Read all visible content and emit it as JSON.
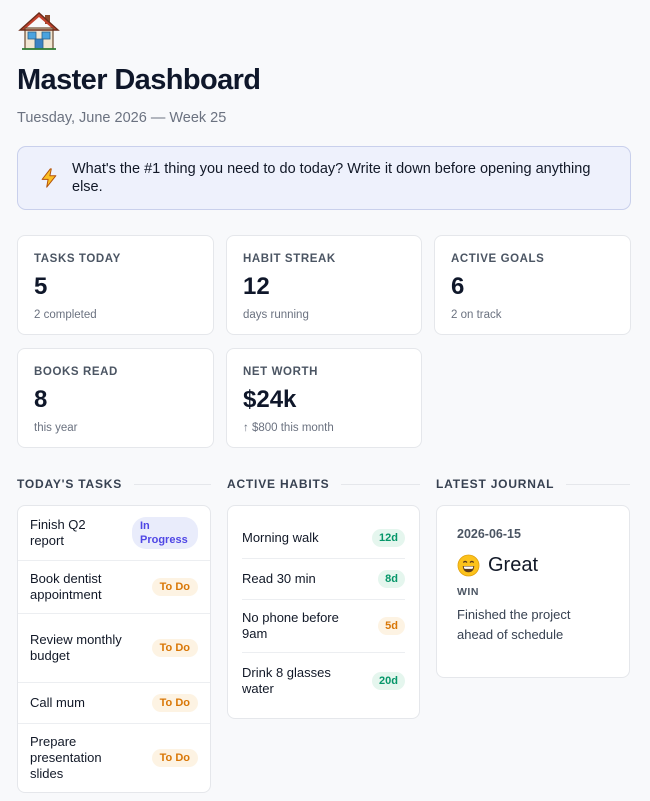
{
  "header": {
    "icon": "house-icon",
    "title": "Master Dashboard",
    "subtitle": "Tuesday, June 2026 — Week 25"
  },
  "callout": {
    "icon": "lightning-bolt-icon",
    "text": "What's the #1 thing you need to do today? Write it down before opening anything else."
  },
  "stats": [
    {
      "label": "TASKS TODAY",
      "value": "5",
      "sub": "2 completed"
    },
    {
      "label": "HABIT STREAK",
      "value": "12",
      "sub": "days running"
    },
    {
      "label": "ACTIVE GOALS",
      "value": "6",
      "sub": "2 on track"
    },
    {
      "label": "BOOKS READ",
      "value": "8",
      "sub": "this year"
    },
    {
      "label": "NET WORTH",
      "value": "$24k",
      "sub": "↑ $800 this month"
    }
  ],
  "tasks": {
    "title": "TODAY'S TASKS",
    "items": [
      {
        "name": "Finish Q2 report",
        "status": "In Progress"
      },
      {
        "name": "Book dentist appointment",
        "status": "To Do"
      },
      {
        "name": "Review monthly budget",
        "status": "To Do"
      },
      {
        "name": "Call mum",
        "status": "To Do"
      },
      {
        "name": "Prepare presentation slides",
        "status": "To Do"
      }
    ]
  },
  "habits": {
    "title": "ACTIVE HABITS",
    "items": [
      {
        "name": "Morning walk",
        "streak": "12d"
      },
      {
        "name": "Read 30 min",
        "streak": "8d"
      },
      {
        "name": "No phone before 9am",
        "streak": "5d"
      },
      {
        "name": "Drink 8 glasses water",
        "streak": "20d"
      }
    ]
  },
  "journal": {
    "title": "LATEST JOURNAL",
    "date": "2026-06-15",
    "mood_icon": "grinning-face-icon",
    "mood": "Great",
    "win_label": "WIN",
    "win_text": "Finished the project ahead of schedule"
  },
  "colors": {
    "accent": "#4f46e5",
    "todo": "#d97706",
    "streak_green": "#059669",
    "callout_bg": "#eef1fc"
  }
}
